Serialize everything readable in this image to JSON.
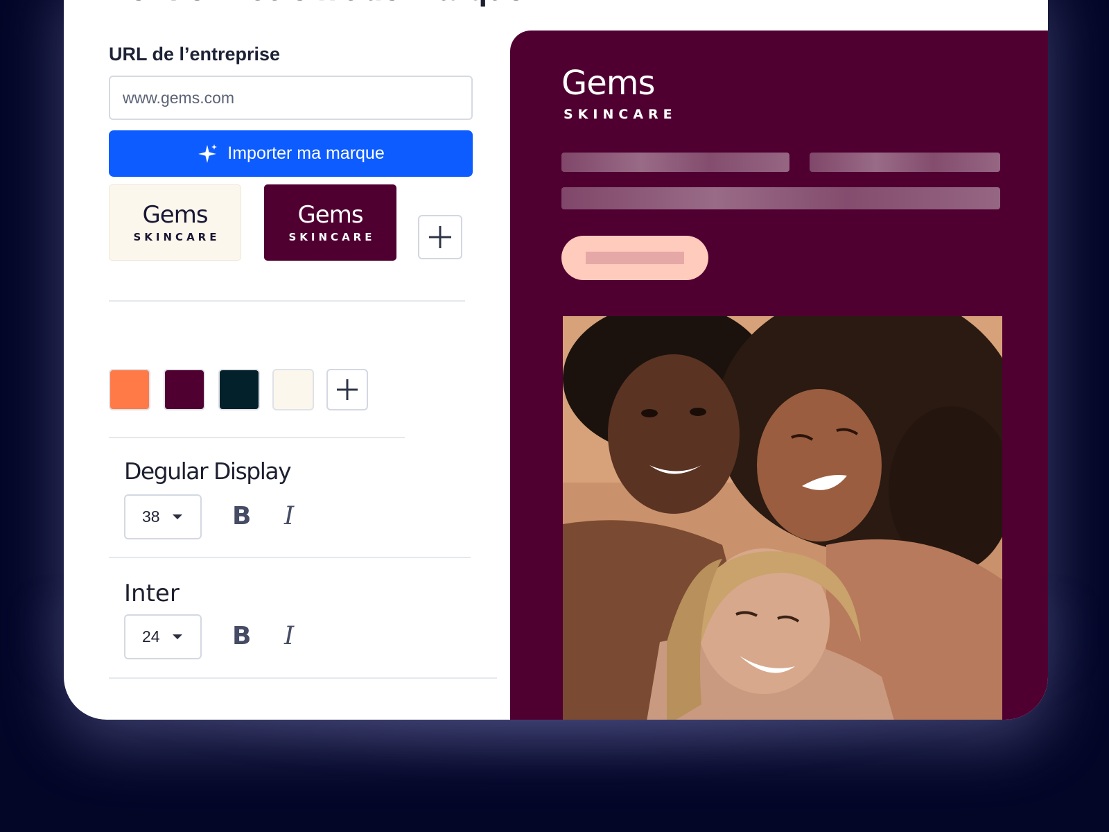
{
  "page": {
    "heading": "Vérifiez votre kit de marque"
  },
  "form": {
    "url_label": "URL de l’entreprise",
    "url_placeholder": "www.gems.com",
    "import_button_label": "Importer ma marque"
  },
  "logos": [
    {
      "wordmark": "Gems",
      "subline": "SKINCARE",
      "variant": "light"
    },
    {
      "wordmark": "Gems",
      "subline": "SKINCARE",
      "variant": "dark"
    }
  ],
  "colors": [
    "#ff7a47",
    "#4f0030",
    "#03212b",
    "#fbf7ec"
  ],
  "fonts": [
    {
      "name": "Degular Display",
      "size": "38"
    },
    {
      "name": "Inter",
      "size": "24"
    }
  ],
  "format": {
    "bold": "B",
    "italic": "I"
  },
  "preview": {
    "wordmark": "Gems",
    "subline": "SKINCARE"
  },
  "theme": {
    "accent": "#0d5cff",
    "brand_dark": "#4f0030",
    "brand_light": "#fbf7ec",
    "button_peach": "#ffcbbd"
  }
}
